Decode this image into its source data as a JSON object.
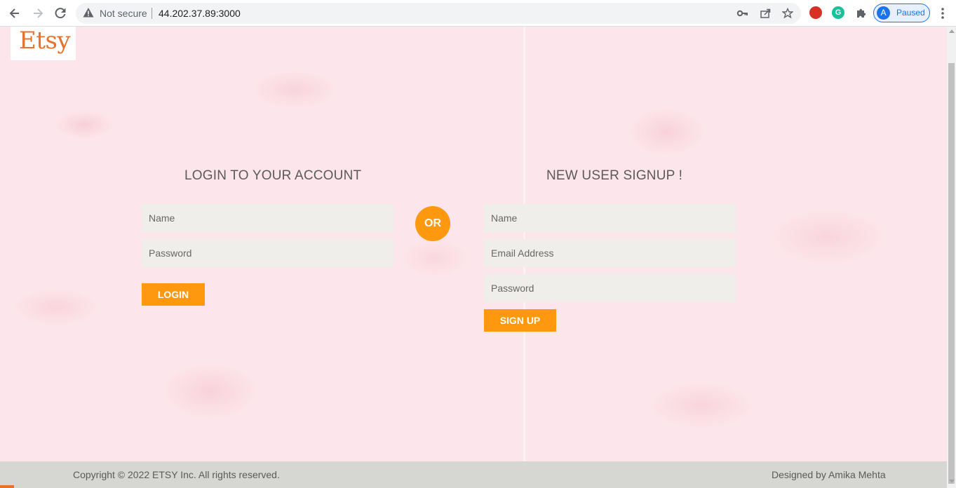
{
  "browser": {
    "security_label": "Not secure",
    "url": "44.202.37.89:3000",
    "profile_initial": "A",
    "profile_status": "Paused",
    "icons": [
      "back-arrow-icon",
      "forward-arrow-icon",
      "reload-icon",
      "warning-icon",
      "key-icon",
      "share-icon",
      "star-icon",
      "extension-icon",
      "grammarly-icon",
      "puzzle-icon",
      "menu-dots-icon"
    ]
  },
  "brand": {
    "logo": "Etsy"
  },
  "login": {
    "heading": "LOGIN TO YOUR ACCOUNT",
    "name_placeholder": "Name",
    "password_placeholder": "Password",
    "button": "LOGIN"
  },
  "divider": {
    "label": "OR"
  },
  "signup": {
    "heading": "NEW USER SIGNUP !",
    "name_placeholder": "Name",
    "email_placeholder": "Email Address",
    "password_placeholder": "Password",
    "button": "SIGN UP"
  },
  "footer": {
    "copyright": "Copyright © 2022 ETSY Inc. All rights reserved.",
    "credit": "Designed by Amika Mehta"
  },
  "colors": {
    "accent": "#fe980f",
    "logo": "#e8712c",
    "background": "#fde6eb",
    "footer": "#d6d6d2"
  }
}
